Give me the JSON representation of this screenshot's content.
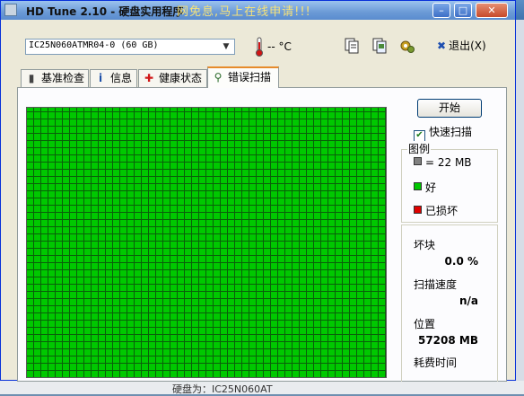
{
  "background": {
    "promo_text": "网免息,马上在线申请!!!",
    "status_text": "硬盘为：IC25N060AT"
  },
  "window": {
    "title": "HD Tune 2.10 - 硬盘实用程序",
    "min_label": "–",
    "max_label": "□",
    "close_label": "✕"
  },
  "toolbar": {
    "drive": "IC25N060ATMR04-0 (60 GB)",
    "temperature": "-- °C",
    "exit_label": "退出(X)",
    "icons": [
      "copy-info-icon",
      "copy-screenshot-icon",
      "options-icon"
    ]
  },
  "tabs": [
    {
      "label": "基准检查",
      "icon": "benchmark-icon",
      "active": false
    },
    {
      "label": "信息",
      "icon": "info-icon",
      "active": false
    },
    {
      "label": "健康状态",
      "icon": "health-icon",
      "active": false
    },
    {
      "label": "错误扫描",
      "icon": "magnifier-icon",
      "active": true
    }
  ],
  "scan": {
    "start_label": "开始",
    "quick_scan_label": "快速扫描",
    "quick_scan_checked": true,
    "block_color": "#00c800"
  },
  "legend": {
    "title": "图例",
    "items": [
      {
        "label": "= 22 MB",
        "color": "#808080"
      },
      {
        "label": "好",
        "color": "#00c800"
      },
      {
        "label": "已损坏",
        "color": "#e00000"
      }
    ]
  },
  "stats": {
    "bad_blocks_label": "坏块",
    "bad_blocks_value": "0.0 %",
    "scan_speed_label": "扫描速度",
    "scan_speed_value": "n/a",
    "position_label": "位置",
    "position_value": "57208 MB",
    "elapsed_label": "耗费时间"
  }
}
